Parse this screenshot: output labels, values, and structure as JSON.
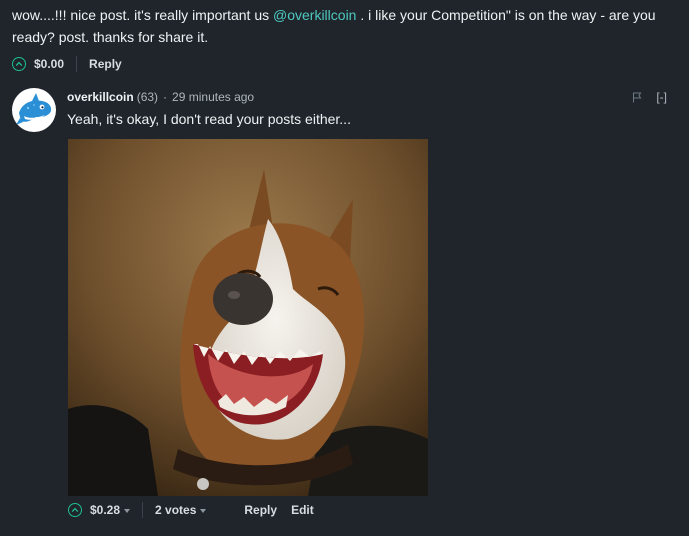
{
  "parent_comment": {
    "text_before": "wow....!!! nice post. it's really important us ",
    "mention": "@overkillcoin",
    "text_after": " . i like your Competition\" is on the way - are you ready? post. thanks for share it.",
    "payout": "$0.00",
    "reply_label": "Reply"
  },
  "reply_comment": {
    "author": "overkillcoin",
    "reputation": "(63)",
    "separator": "·",
    "time_ago": "29 minutes ago",
    "body": "Yeah, it's okay, I don't read your posts either...",
    "collapse_label": "[-]",
    "payout": "$0.28",
    "votes_label": "2 votes",
    "reply_label": "Reply",
    "edit_label": "Edit",
    "image_subject": "laughing-dog-photo",
    "avatar_subject": "blue-orca-mascot"
  },
  "colors": {
    "background": "#1f252b",
    "accent": "#1fbf8f",
    "mention": "#4ec9c0"
  }
}
